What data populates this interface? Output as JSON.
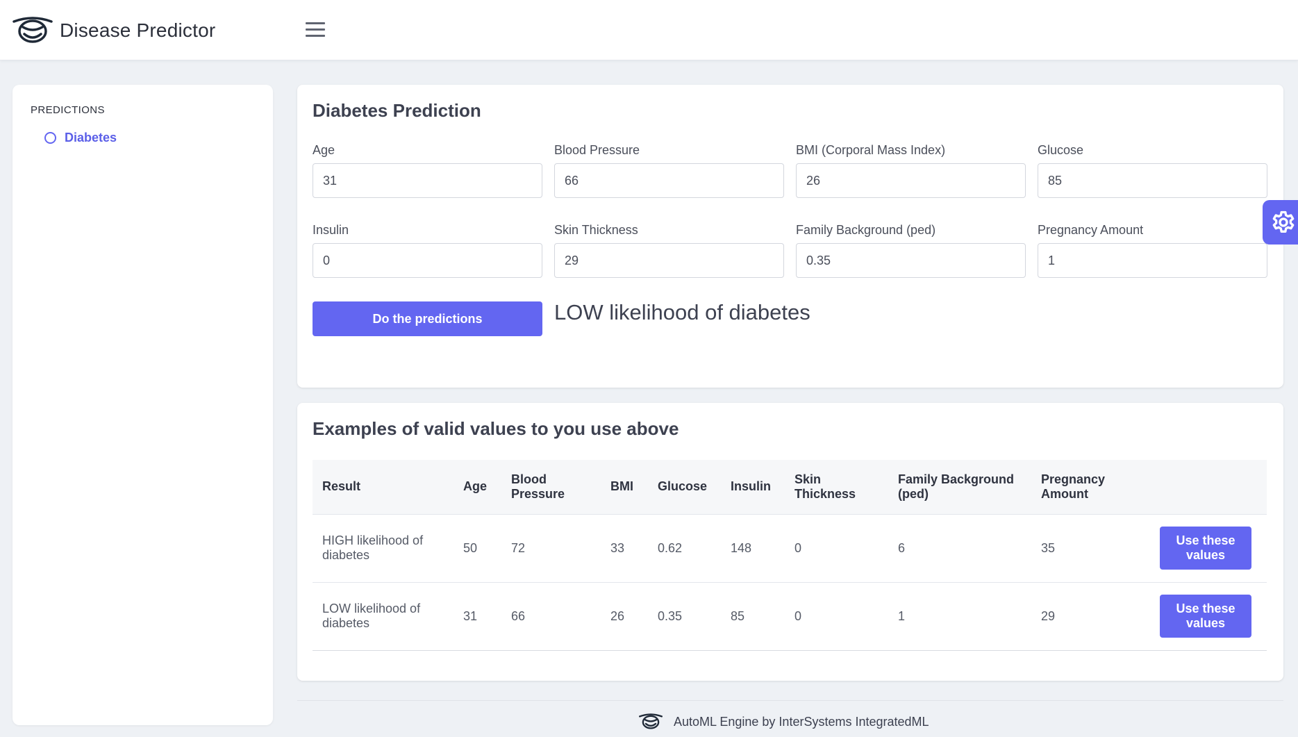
{
  "header": {
    "brand_name": "Disease Predictor",
    "logo_icon": "smile-logo-icon",
    "menu_icon": "hamburger-menu-icon"
  },
  "sidebar": {
    "heading": "PREDICTIONS",
    "items": [
      {
        "label": "Diabetes",
        "icon": "circle-outline-icon",
        "active": true
      }
    ]
  },
  "prediction": {
    "title": "Diabetes Prediction",
    "fields": {
      "age": {
        "label": "Age",
        "value": "31"
      },
      "blood_pressure": {
        "label": "Blood Pressure",
        "value": "66"
      },
      "bmi": {
        "label": "BMI (Corporal Mass Index)",
        "value": "26"
      },
      "glucose": {
        "label": "Glucose",
        "value": "85"
      },
      "insulin": {
        "label": "Insulin",
        "value": "0"
      },
      "skin_thickness": {
        "label": "Skin Thickness",
        "value": "29"
      },
      "family_background": {
        "label": "Family Background (ped)",
        "value": "0.35"
      },
      "pregnancy_amount": {
        "label": "Pregnancy Amount",
        "value": "1"
      }
    },
    "button_label": "Do the predictions",
    "result": "LOW likelihood of diabetes"
  },
  "examples": {
    "title": "Examples of valid values to you use above",
    "headers": {
      "result": "Result",
      "age": "Age",
      "blood_pressure": "Blood Pressure",
      "bmi": "BMI",
      "glucose": "Glucose",
      "insulin": "Insulin",
      "skin_thickness": "Skin Thickness",
      "family_background": "Family Background (ped)",
      "pregnancy_amount": "Pregnancy Amount"
    },
    "rows": [
      {
        "result": "HIGH likelihood of diabetes",
        "age": "50",
        "blood_pressure": "72",
        "bmi": "33",
        "glucose": "0.62",
        "insulin": "148",
        "skin_thickness": "0",
        "family_background": "6",
        "pregnancy_amount": "35",
        "action": "Use these values"
      },
      {
        "result": "LOW likelihood of diabetes",
        "age": "31",
        "blood_pressure": "66",
        "bmi": "26",
        "glucose": "0.35",
        "insulin": "85",
        "skin_thickness": "0",
        "family_background": "1",
        "pregnancy_amount": "29",
        "action": "Use these values"
      }
    ]
  },
  "settings": {
    "icon": "gear-icon"
  },
  "footer": {
    "text": "AutoML Engine by InterSystems IntegratedML",
    "logo_icon": "smile-logo-icon"
  },
  "colors": {
    "accent": "#6366f1",
    "background": "#eef1f5",
    "card": "#ffffff",
    "text": "#3d4150"
  }
}
